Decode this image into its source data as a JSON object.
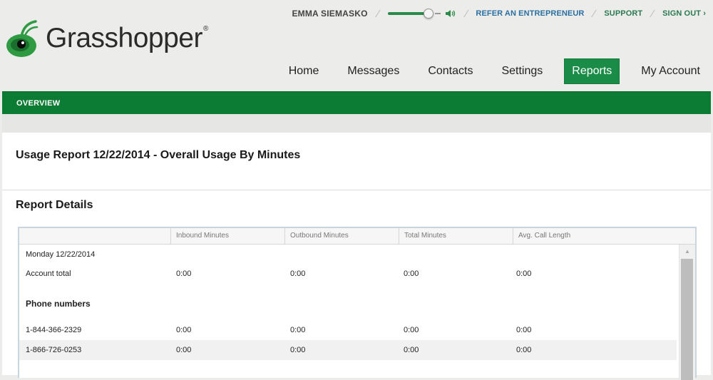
{
  "header": {
    "brand": "Grasshopper",
    "brand_mark": "®",
    "user_name": "EMMA SIEMASKO",
    "links": {
      "refer": "REFER AN ENTREPRENEUR",
      "support": "SUPPORT",
      "sign_out": "SIGN OUT ›"
    },
    "volume_level": 0.85
  },
  "nav": {
    "items": [
      {
        "label": "Home",
        "active": false
      },
      {
        "label": "Messages",
        "active": false
      },
      {
        "label": "Contacts",
        "active": false
      },
      {
        "label": "Settings",
        "active": false
      },
      {
        "label": "Reports",
        "active": true
      },
      {
        "label": "My Account",
        "active": false
      }
    ]
  },
  "subnav": {
    "active_tab": "OVERVIEW"
  },
  "report": {
    "title": "Usage Report 12/22/2014  - Overall Usage By Minutes",
    "section_title": "Report Details",
    "columns": [
      "Inbound Minutes",
      "Outbound Minutes",
      "Total Minutes",
      "Avg. Call Length"
    ],
    "date_row": "Monday 12/22/2014",
    "account_total": {
      "label": "Account total",
      "values": [
        "0:00",
        "0:00",
        "0:00",
        "0:00"
      ]
    },
    "phone_numbers_label": "Phone numbers",
    "phone_rows": [
      {
        "number": "1-844-366-2329",
        "values": [
          "0:00",
          "0:00",
          "0:00",
          "0:00"
        ]
      },
      {
        "number": "1-866-726-0253",
        "values": [
          "0:00",
          "0:00",
          "0:00",
          "0:00"
        ]
      }
    ]
  },
  "colors": {
    "brand_green": "#1b8c47",
    "subbar_green": "#0c7c34",
    "link_blue": "#2a6fa0"
  }
}
